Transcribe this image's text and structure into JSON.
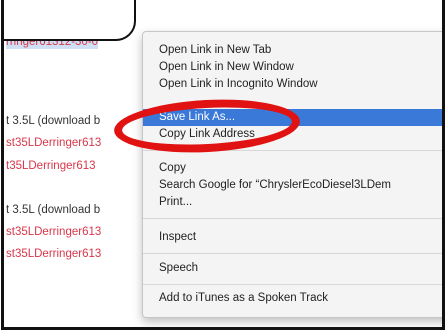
{
  "page": {
    "link_fragment": "rringer61312-30-0",
    "lines": [
      {
        "text": "t 3.5L (download b",
        "kind": "black"
      },
      {
        "text": "st35LDerringer613",
        "kind": "red"
      },
      {
        "text": "t35LDerringer613",
        "kind": "red"
      },
      {
        "text": "t 3.5L (download b",
        "kind": "black"
      },
      {
        "text": "st35LDerringer613",
        "kind": "red"
      },
      {
        "text": "st35LDerringer613",
        "kind": "red"
      }
    ]
  },
  "context_menu": {
    "items": [
      {
        "label": "Open Link in New Tab"
      },
      {
        "label": "Open Link in New Window"
      },
      {
        "label": "Open Link in Incognito Window"
      },
      {
        "label": "Save Link As...",
        "selected": true
      },
      {
        "label": "Copy Link Address"
      },
      {
        "label": "Copy"
      },
      {
        "label": "Search Google for “ChryslerEcoDiesel3LDem"
      },
      {
        "label": "Print..."
      },
      {
        "label": "Inspect"
      },
      {
        "label": "Speech"
      },
      {
        "label": "Add to iTunes as a Spoken Track"
      }
    ]
  },
  "annotation": {
    "color": "#e01212"
  }
}
